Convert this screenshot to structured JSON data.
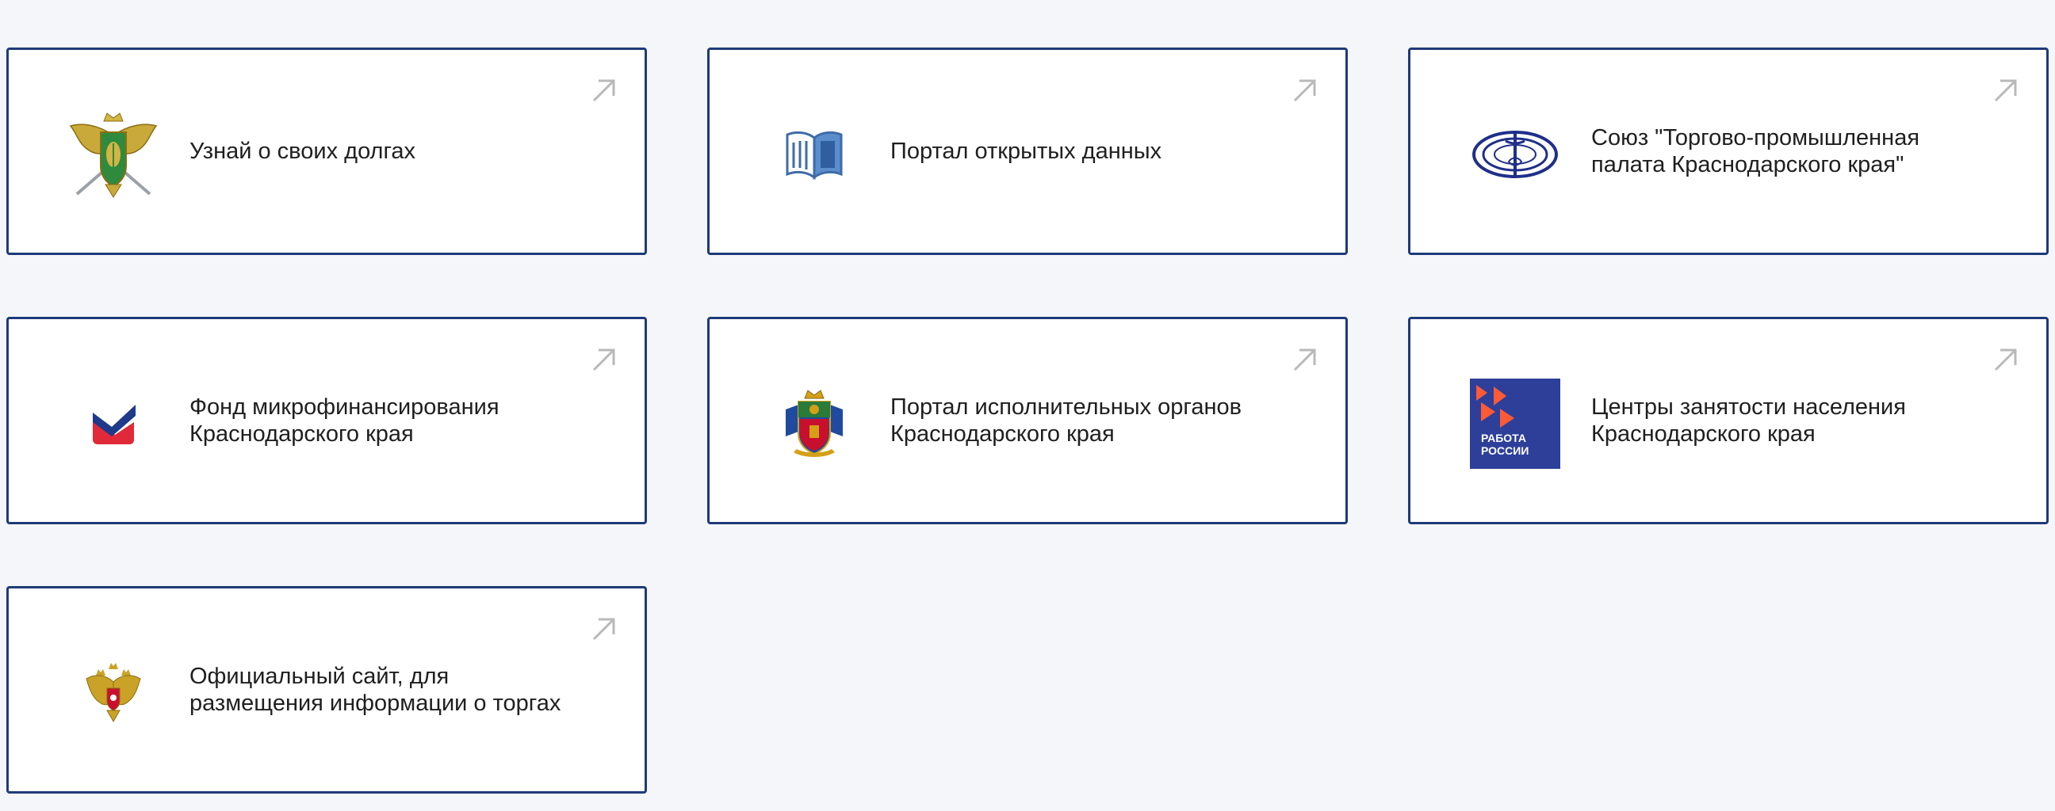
{
  "cards": [
    {
      "label": "Узнай о своих долгах",
      "logo_icon": "fssp-emblem-icon"
    },
    {
      "label": "Портал открытых данных",
      "logo_icon": "open-data-book-icon"
    },
    {
      "label": "Союз \"Торгово-промышленная\nпалата Краснодарского края\"",
      "logo_icon": "chamber-of-commerce-icon"
    },
    {
      "label": "Фонд микрофинансирования\nКраснодарского края",
      "logo_icon": "microfinance-fund-check-icon"
    },
    {
      "label": "Портал исполнительных органов\nКраснодарского края",
      "logo_icon": "krasnodar-coat-of-arms-icon"
    },
    {
      "label": "Центры занятости населения\nКраснодарского края",
      "logo_icon": "rabota-rossii-logo-icon",
      "logo_text": [
        "РАБОТА",
        "РОССИИ"
      ]
    },
    {
      "label": "Официальный сайт, для\nразмещения информации о торгах",
      "logo_icon": "russia-coat-of-arms-icon"
    }
  ],
  "colors": {
    "page_background": "#f4f6fa",
    "card_border": "#1e3a78",
    "card_background": "#ffffff",
    "text": "#1f1f1f",
    "arrow": "#b9b9b9"
  },
  "external_link_icon": "arrow-up-right-icon"
}
